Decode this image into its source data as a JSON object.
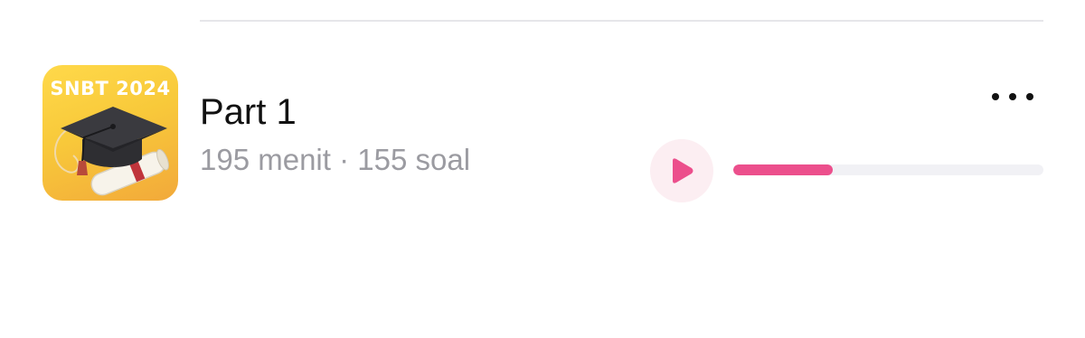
{
  "item": {
    "thumbnail_label": "SNBT 2024",
    "title": "Part 1",
    "duration": "195 menit",
    "separator": "·",
    "question_count": "155 soal",
    "progress_fraction": 0.32
  },
  "icons": {
    "more": "more-horizontal-icon",
    "play": "play-icon",
    "thumbnail": "graduation-cap-diploma-icon"
  },
  "colors": {
    "accent": "#ec4f8c",
    "play_bg": "#fceef2",
    "track": "#f1f1f5",
    "meta_text": "#9b9ba1",
    "thumb_yellow": "#f8c93a"
  }
}
